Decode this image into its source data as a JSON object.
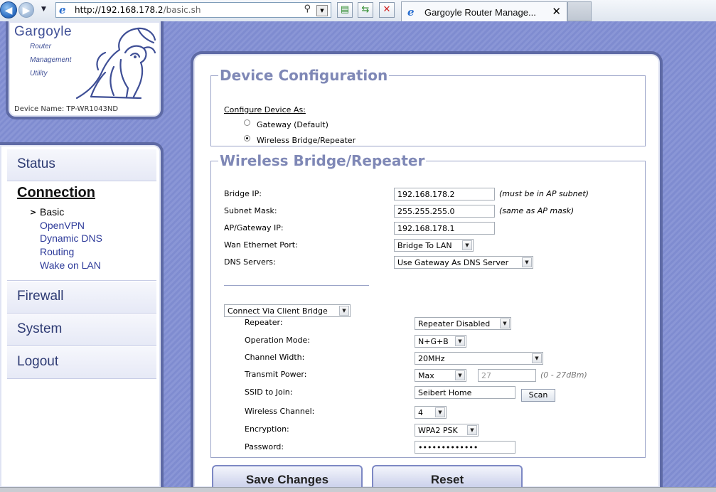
{
  "browser": {
    "url_host": "http://192.168.178.2",
    "url_path": "/basic.sh",
    "tab_title": "Gargoyle Router Manage...",
    "tab_close": "✕"
  },
  "logo": {
    "title": "Gargoyle",
    "sub1": "Router",
    "sub2": "Management",
    "sub3": "Utility",
    "device_name": "Device Name: TP-WR1043ND"
  },
  "nav": {
    "status": "Status",
    "connection": "Connection",
    "current_marker": ">",
    "sub_items": [
      "Basic",
      "OpenVPN",
      "Dynamic DNS",
      "Routing",
      "Wake on LAN"
    ],
    "firewall": "Firewall",
    "system": "System",
    "logout": "Logout"
  },
  "device_config": {
    "legend": "Device Configuration",
    "configure_as": "Configure Device As:",
    "opt_gateway": "Gateway (Default)",
    "opt_bridge": "Wireless Bridge/Repeater",
    "selected": "bridge"
  },
  "bridge": {
    "legend": "Wireless Bridge/Repeater",
    "bridge_ip_label": "Bridge IP:",
    "bridge_ip": "192.168.178.2",
    "bridge_ip_note": "(must be in AP subnet)",
    "subnet_label": "Subnet Mask:",
    "subnet": "255.255.255.0",
    "subnet_note": "(same as AP mask)",
    "gateway_label": "AP/Gateway IP:",
    "gateway": "192.168.178.1",
    "wan_port_label": "Wan Ethernet Port:",
    "wan_port": "Bridge To LAN",
    "dns_label": "DNS Servers:",
    "dns": "Use Gateway As DNS Server",
    "connect_via": "Connect Via Client Bridge",
    "repeater_label": "Repeater:",
    "repeater": "Repeater Disabled",
    "op_mode_label": "Operation Mode:",
    "op_mode": "N+G+B",
    "channel_width_label": "Channel Width:",
    "channel_width": "20MHz",
    "tx_power_label": "Transmit Power:",
    "tx_power": "Max",
    "tx_power_value": "27",
    "tx_power_note": "(0 - 27dBm)",
    "ssid_label": "SSID to Join:",
    "ssid": "Seibert Home",
    "scan": "Scan",
    "channel_label": "Wireless Channel:",
    "channel": "4",
    "encryption_label": "Encryption:",
    "encryption": "WPA2 PSK",
    "password_label": "Password:",
    "password": "•••••••••••••"
  },
  "actions": {
    "save": "Save Changes",
    "reset": "Reset"
  }
}
